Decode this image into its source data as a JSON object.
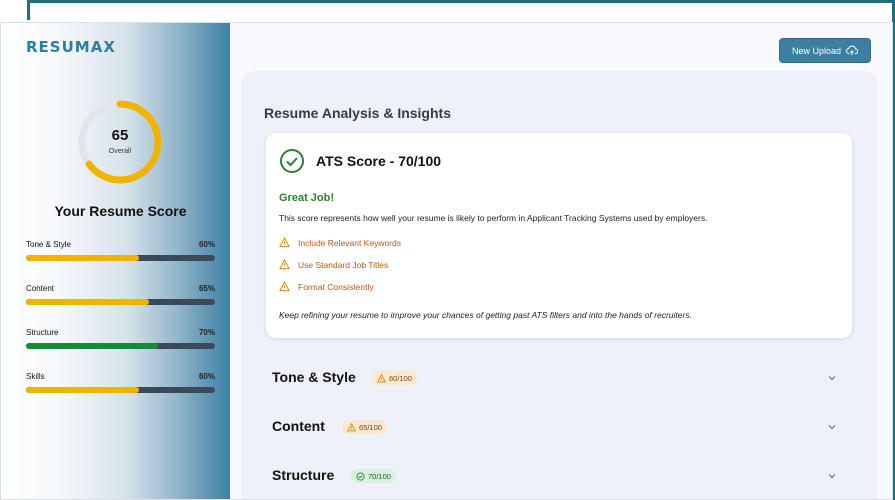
{
  "app": {
    "logo": "RESUMAX"
  },
  "header": {
    "upload_label": "New Upload"
  },
  "sidebar": {
    "overall": {
      "value": "65",
      "label": "Overall",
      "fraction": 0.65
    },
    "title": "Your Resume Score",
    "metrics": [
      {
        "label": "Tone & Style",
        "pct": "60%",
        "value": 0.6,
        "color": "#f0b400"
      },
      {
        "label": "Content",
        "pct": "65%",
        "value": 0.65,
        "color": "#f0b400"
      },
      {
        "label": "Structure",
        "pct": "70%",
        "value": 0.7,
        "color": "#1a8a3a"
      },
      {
        "label": "Skills",
        "pct": "60%",
        "value": 0.6,
        "color": "#f0b400"
      }
    ]
  },
  "main": {
    "title": "Resume Analysis & Insights",
    "ats": {
      "title": "ATS Score - 70/100",
      "headline": "Great Job!",
      "description": "This score represents how well your resume is likely to perform in Applicant Tracking Systems used by employers.",
      "tips": [
        "Include Relevant Keywords",
        "Use Standard Job Titles",
        "Format Consistently"
      ],
      "closing": "Keep refining your resume to improve your chances of getting past ATS filters and into the hands of recruiters."
    },
    "sections": [
      {
        "title": "Tone & Style",
        "badge": "60/100",
        "status": "warn"
      },
      {
        "title": "Content",
        "badge": "65/100",
        "status": "warn"
      },
      {
        "title": "Structure",
        "badge": "70/100",
        "status": "good"
      }
    ]
  },
  "colors": {
    "accent": "#3d7fa3",
    "warning": "#f0b400",
    "success": "#1a8a3a",
    "tip": "#c0551a"
  },
  "icons": {
    "upload": "cloud-upload-icon",
    "ats": "check-circle-icon",
    "tip": "warning-icon",
    "expand": "chevron-down-icon"
  }
}
